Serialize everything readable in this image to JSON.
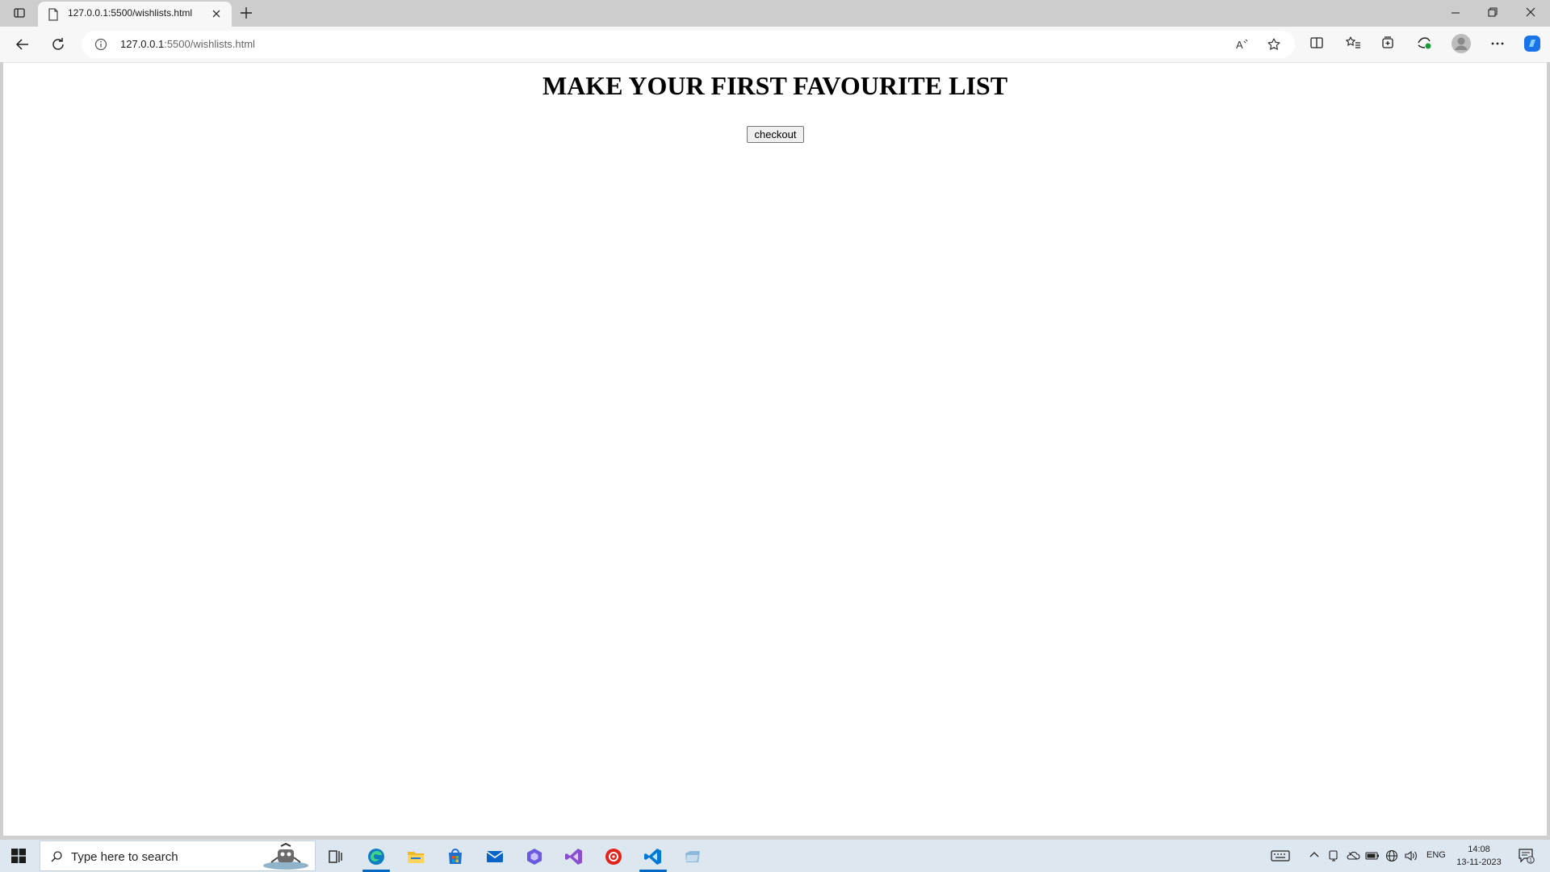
{
  "browser": {
    "tab": {
      "title": "127.0.0.1:5500/wishlists.html"
    },
    "address": {
      "host": "127.0.0.1",
      "path": ":5500/wishlists.html"
    }
  },
  "page": {
    "heading": "MAKE YOUR FIRST FAVOURITE LIST",
    "checkout_label": "checkout"
  },
  "taskbar": {
    "search_placeholder": "Type here to search",
    "language": "ENG",
    "time": "14:08",
    "date": "13-11-2023",
    "notification_count": "1"
  },
  "colors": {
    "accent": "#0067c0",
    "copilot": "#1a73e8",
    "taskbar_bg": "#dde7f0"
  }
}
